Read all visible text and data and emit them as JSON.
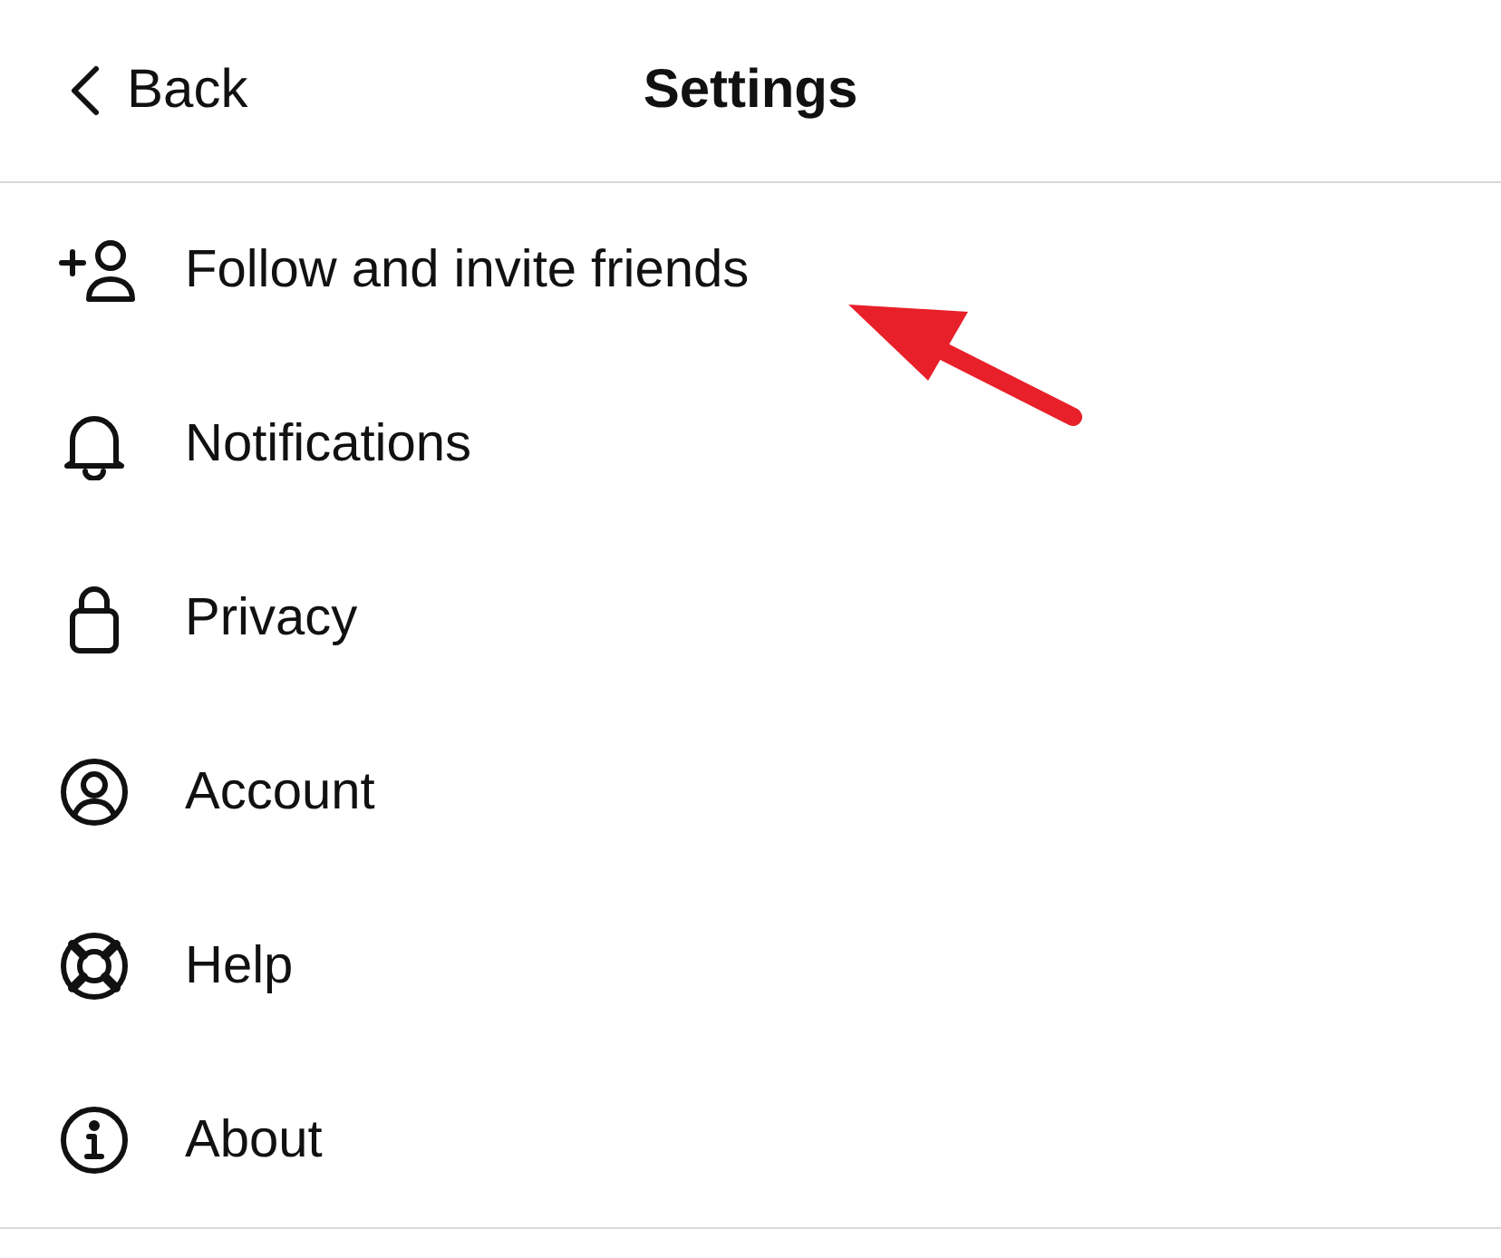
{
  "nav_bar": {
    "back": "Back",
    "title": "Settings"
  },
  "items": [
    {
      "label": "Follow and invite friends"
    },
    {
      "label": "Notifications"
    },
    {
      "label": "Privacy"
    },
    {
      "label": "Account"
    },
    {
      "label": "Help"
    },
    {
      "label": "About"
    }
  ]
}
